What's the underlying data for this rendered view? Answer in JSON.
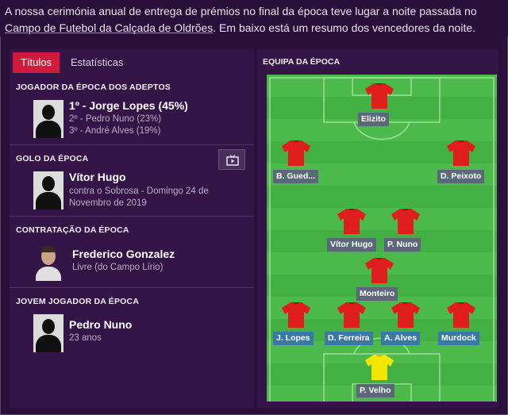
{
  "intro": {
    "part1": "A nossa cerimónia anual de entrega de prémios no final da época teve lugar a noite passada no ",
    "stadium_link": "Campo de Futebol da Calçada de Oldrões",
    "part2": ". Em baixo está um resumo dos vencedores da noite."
  },
  "tabs": [
    "Títulos",
    "Estatísticas"
  ],
  "awards": {
    "fan_player": {
      "title": "JOGADOR DA ÉPOCA DOS ADEPTOS",
      "winner": "1º - Jorge Lopes (45%)",
      "second": "2º - Pedro Nuno (23%)",
      "third": "3º - André Alves (19%)"
    },
    "goal": {
      "title": "GOLO DA ÉPOCA",
      "name": "Vítor Hugo",
      "detail_line1": "contra o Sobrosa - Domingo 24 de",
      "detail_line2": "Novembro de 2019",
      "video_icon": "tv-icon"
    },
    "signing": {
      "title": "CONTRATAÇÃO DA ÉPOCA",
      "name": "Frederico Gonzalez",
      "detail": "Livre (do Campo Lírio)"
    },
    "young": {
      "title": "JOVEM JOGADOR DA ÉPOCA",
      "name": "Pedro Nuno",
      "detail": "23 anos"
    }
  },
  "team_of_season": {
    "title": "EQUIPA DA ÉPOCA",
    "players": {
      "st": "Elizito",
      "lw": "B. Gued...",
      "rw": "D. Peixoto",
      "cm_left": "Vítor Hugo",
      "cm_right": "P. Nuno",
      "dm": "Monteiro",
      "lb": "J. Lopes",
      "lcb": "D. Ferreira",
      "rcb": "A. Alves",
      "rb": "Murdock",
      "gk": "P. Velho"
    }
  },
  "colors": {
    "accent": "#d21b3c",
    "panel": "#351447",
    "pitch": "#43b044",
    "shirt": "#e01e1e",
    "keeper_shirt": "#f2e600"
  }
}
